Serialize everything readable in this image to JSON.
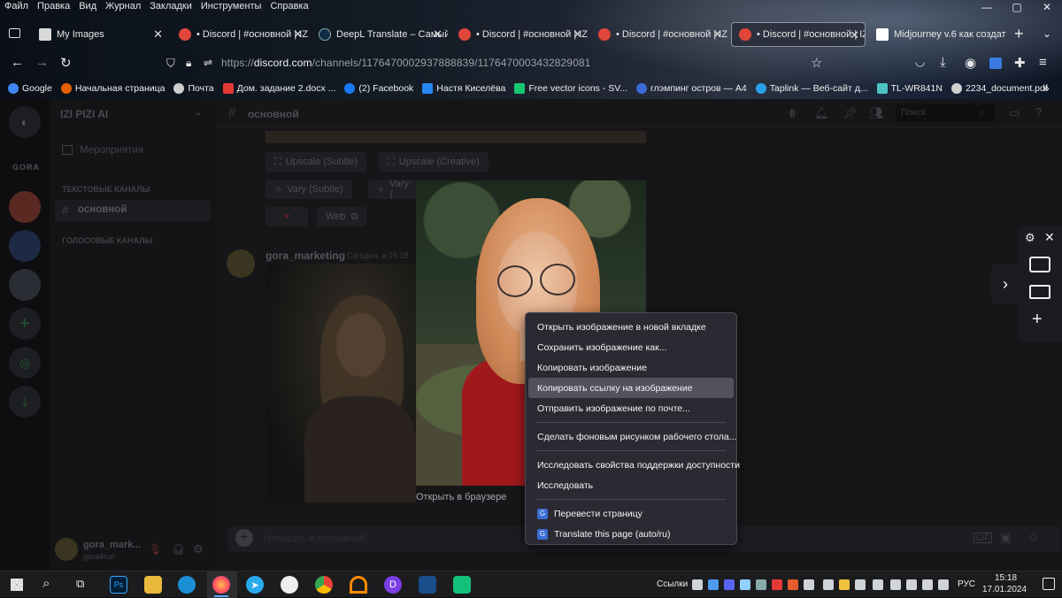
{
  "menubar": [
    "Файл",
    "Правка",
    "Вид",
    "Журнал",
    "Закладки",
    "Инструменты",
    "Справка"
  ],
  "window_controls": [
    "—",
    "▢",
    "✕"
  ],
  "tabs": [
    {
      "label": "My Images",
      "icon_color": "#d9d9d9"
    },
    {
      "label": "• Discord | #основной | IZI",
      "icon_color": "#e0463a"
    },
    {
      "label": "DeepL Translate – Самый т",
      "icon_color": "#0f2b46"
    },
    {
      "label": "• Discord | #основной | IZI",
      "icon_color": "#e0463a"
    },
    {
      "label": "• Discord | #основной | IZI",
      "icon_color": "#e0463a"
    },
    {
      "label": "• Discord | #основной | IZI",
      "icon_color": "#e0463a"
    },
    {
      "label": "Midjourney v.6 как создат",
      "icon_color": "#ffffff"
    }
  ],
  "new_tab": "+",
  "url": {
    "prefix": "https://",
    "host": "discord.com",
    "path": "/channels/1176470002937888839/1176470003432829081"
  },
  "bookmarks": [
    {
      "label": "Google",
      "color": "#4285f4"
    },
    {
      "label": "Начальная страница",
      "color": "#e66000"
    },
    {
      "label": "Почта",
      "color": "#cfcfcf"
    },
    {
      "label": "Дом. задание 2.docx ...",
      "color": "#e53935"
    },
    {
      "label": "(2) Facebook",
      "color": "#1877f2"
    },
    {
      "label": "Настя Киселёва",
      "color": "#2787f5"
    },
    {
      "label": "Free vector icons - SV...",
      "color": "#16c872"
    },
    {
      "label": "глэмпинг остров — А4",
      "color": "#3b6cd6"
    },
    {
      "label": "Taplink — Веб-сайт д...",
      "color": "#2aa0e8"
    },
    {
      "label": "TL-WR841N",
      "color": "#4fc3c3"
    },
    {
      "label": "2234_document.pdf",
      "color": "#cfcfcf"
    }
  ],
  "discord": {
    "server_name": "IZI PIZI AI",
    "gora_label": "GORA",
    "events": "Мероприятия",
    "text_channels": "ТЕКСТОВЫЕ КАНАЛЫ",
    "channel": "основной",
    "voice_channels": "ГОЛОСОВЫЕ КАНАЛЫ",
    "topbar_channel": "основной",
    "search_placeholder": "Поиск",
    "buttons": [
      "Upscale (Subtle)",
      "Upscale (Creative)",
      "Vary (Subtle)",
      "Vary (",
      "Web"
    ],
    "message_author": "gora_marketing",
    "message_time": "Сегодня, в 15:18",
    "open_in_browser": "Открыть в браузере",
    "user_name": "gora_mark...",
    "user_tag": "gora4run",
    "message_placeholder": "Написать в #основной"
  },
  "context_menu": [
    {
      "label": "Открыть изображение в новой вкладке",
      "highlighted": false
    },
    {
      "label": "Сохранить изображение как...",
      "highlighted": false
    },
    {
      "label": "Копировать изображение",
      "highlighted": false
    },
    {
      "label": "Копировать ссылку на изображение",
      "highlighted": true
    },
    {
      "label": "Отправить изображение по почте...",
      "highlighted": false
    },
    {
      "label": "Сделать фоновым рисунком рабочего стола...",
      "highlighted": false
    },
    {
      "label": "Исследовать свойства поддержки доступности",
      "highlighted": false
    },
    {
      "label": "Исследовать",
      "highlighted": false
    },
    {
      "label": "Перевести страницу",
      "highlighted": false
    },
    {
      "label": "Translate this page (auto/ru)",
      "highlighted": false
    }
  ],
  "taskbar": {
    "links_label": "Ссылки",
    "lang": "РУС",
    "time": "15:18",
    "date": "17.01.2024"
  }
}
